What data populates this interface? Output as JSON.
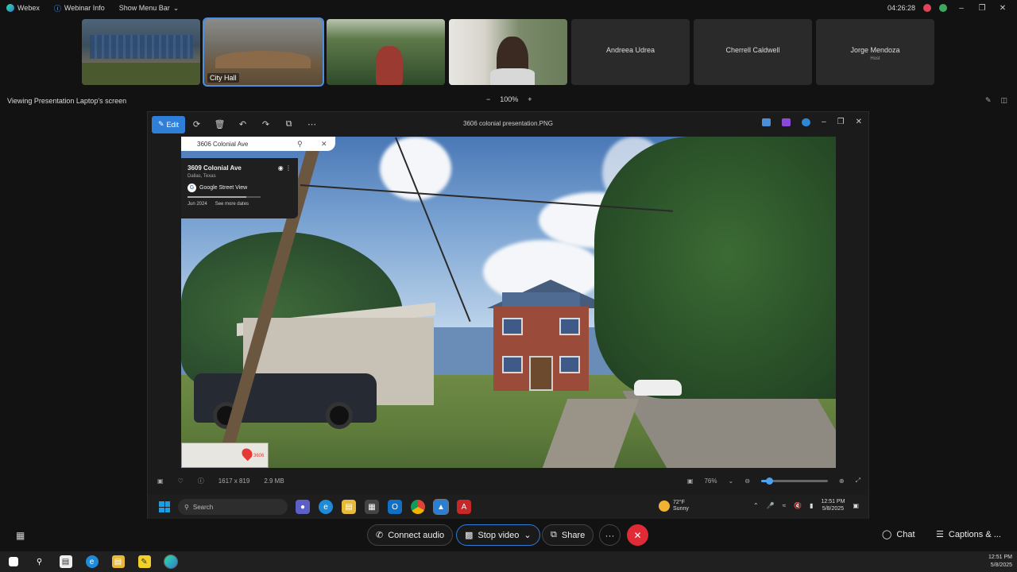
{
  "topbar": {
    "app_name": "Webex",
    "webinar_info": "Webinar Info",
    "show_menu_bar": "Show Menu Bar",
    "timer": "04:26:28"
  },
  "participants": [
    {
      "type": "video",
      "label": ""
    },
    {
      "type": "video",
      "label": "City Hall",
      "active": true
    },
    {
      "type": "video",
      "label": ""
    },
    {
      "type": "video",
      "label": ""
    },
    {
      "type": "name",
      "name": "Andreea Udrea",
      "sub": ""
    },
    {
      "type": "name",
      "name": "Cherrell Caldwell",
      "sub": ""
    },
    {
      "type": "name",
      "name": "Jorge Mendoza",
      "sub": "Host"
    }
  ],
  "viewing": {
    "text": "Viewing Presentation Laptop's screen",
    "zoom": "100%",
    "zoom_out": "−",
    "zoom_in": "+"
  },
  "photos_app": {
    "edit_label": "Edit",
    "file_title": "3606 colonial presentation.PNG",
    "dimensions": "1617 x 819",
    "filesize": "2.9 MB",
    "zoom_level": "76%",
    "zoom_fraction": 0.12
  },
  "maps": {
    "search_value": "3606 Colonial Ave",
    "place_title": "3609 Colonial Ave",
    "place_sub": "Dallas, Texas",
    "source": "Google Street View",
    "date": "Jun 2024",
    "more_dates": "See more dates",
    "minimap_label": "3606"
  },
  "inner_taskbar": {
    "search_placeholder": "Search",
    "weather_temp": "72°F",
    "weather_cond": "Sunny",
    "time": "12:51 PM",
    "date": "5/8/2025"
  },
  "controls": {
    "connect_audio": "Connect audio",
    "stop_video": "Stop video",
    "share": "Share",
    "more": "···",
    "chat": "Chat",
    "captions": "Captions & ..."
  },
  "os_taskbar": {
    "time": "12:51 PM",
    "date": "5/8/2025"
  },
  "colors": {
    "accent": "#2e7cd6",
    "end_call": "#e02b37"
  }
}
